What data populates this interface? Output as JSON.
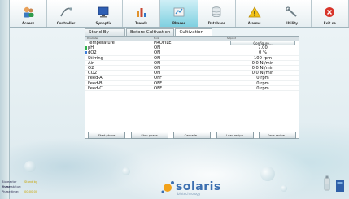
{
  "toolbar": {
    "buttons": [
      {
        "label": "Access",
        "icon": "users-icon",
        "active": false
      },
      {
        "label": "Controller",
        "icon": "controller-icon",
        "active": false
      },
      {
        "label": "Synoptic",
        "icon": "synoptic-icon",
        "active": false
      },
      {
        "label": "Trends",
        "icon": "trends-icon",
        "active": false
      },
      {
        "label": "Phases",
        "icon": "phases-icon",
        "active": true
      },
      {
        "label": "Database",
        "icon": "database-icon",
        "active": false
      },
      {
        "label": "Alarms",
        "icon": "alarm-icon",
        "active": false
      },
      {
        "label": "Utility",
        "icon": "utility-icon",
        "active": false
      },
      {
        "label": "Exit sa",
        "icon": "exit-icon",
        "active": false
      }
    ]
  },
  "tabs": [
    "Stand By",
    "Before Cultivation",
    "Cultivation"
  ],
  "active_tab": 2,
  "table": {
    "headers": [
      "Parameter",
      "Mode",
      "Setpoint"
    ],
    "configure_label": "Configure...",
    "rows": [
      {
        "name": "Temperature",
        "mode": "PROFILE",
        "setpoint": "",
        "mark": ""
      },
      {
        "name": "pH",
        "mode": "ON",
        "setpoint": "7.00",
        "mark": "#2db34a"
      },
      {
        "name": "dO2",
        "mode": "ON",
        "setpoint": "0 %",
        "mark": "#3b7dd8"
      },
      {
        "name": "Stirring",
        "mode": "ON",
        "setpoint": "100 rpm",
        "mark": ""
      },
      {
        "name": "Air",
        "mode": "ON",
        "setpoint": "0.0 Nl/min",
        "mark": ""
      },
      {
        "name": "O2",
        "mode": "ON",
        "setpoint": "0.0 Nl/min",
        "mark": ""
      },
      {
        "name": "CO2",
        "mode": "ON",
        "setpoint": "0.0 Nl/min",
        "mark": ""
      },
      {
        "name": "Feed-A",
        "mode": "OFF",
        "setpoint": "0 rpm",
        "mark": ""
      },
      {
        "name": "Feed-B",
        "mode": "OFF",
        "setpoint": "0 rpm",
        "mark": ""
      },
      {
        "name": "Feed-C",
        "mode": "OFF",
        "setpoint": "0 rpm",
        "mark": ""
      }
    ]
  },
  "actions": [
    "Start phase",
    "Stop phase",
    "Cascade...",
    "Load recipe",
    "Save recipe..."
  ],
  "footer": {
    "lines": [
      {
        "key": "Bioreactor phase:",
        "value": "Stand by"
      },
      {
        "key": "Phase status:",
        "value": ""
      },
      {
        "key": "Phase time:",
        "value": "00:00:00"
      }
    ]
  },
  "logo": {
    "name": "solaris",
    "sub": "biotechnology"
  },
  "colors": {
    "accent": "#7fd0e0",
    "brand": "#3c6fb0"
  }
}
